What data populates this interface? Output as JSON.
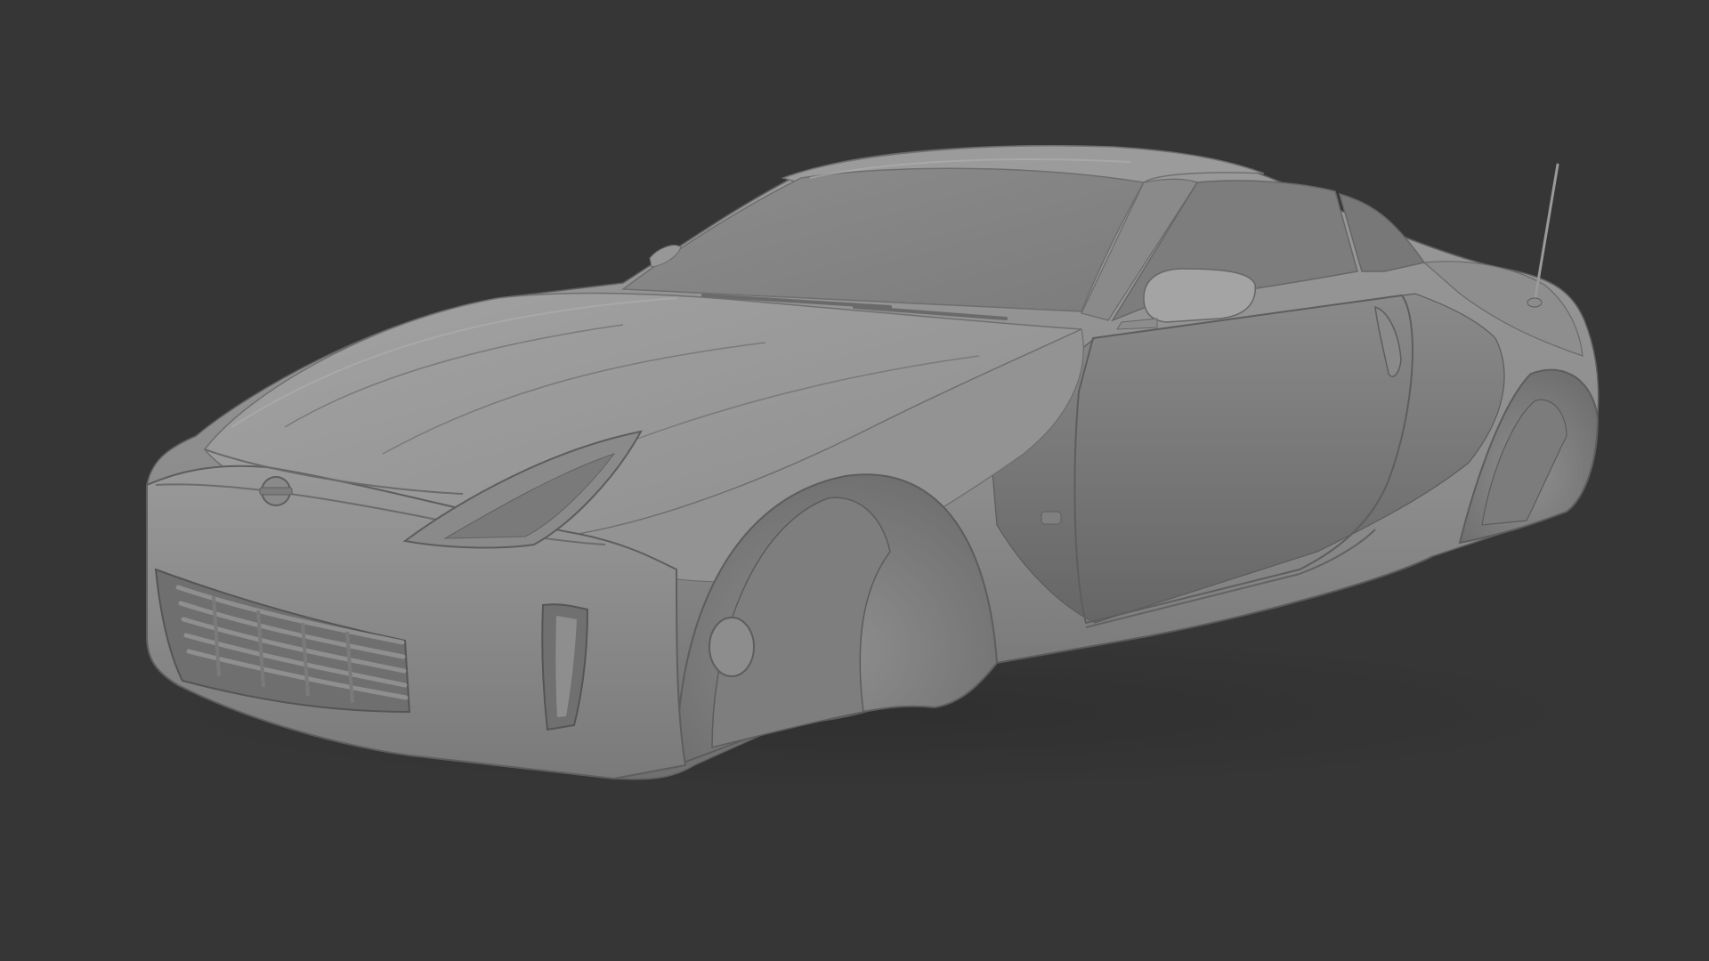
{
  "viewport": {
    "background_color": "#363636",
    "render_style": "clay-grey",
    "subject": "car-body-3d-model"
  },
  "model": {
    "base_color": "#8f8f8f",
    "highlight_color": "#a6a6a6",
    "shadow_color": "#5e5e5e",
    "edge_line_color": "#6a6a6a",
    "parts": [
      "body",
      "hood",
      "windshield",
      "roof",
      "side-window",
      "rear-window",
      "side-mirror",
      "door",
      "door-handle",
      "front-wheel-arch",
      "rear-wheel-arch",
      "front-bumper",
      "grille",
      "headlight",
      "fog-light-slot",
      "emblem",
      "antenna",
      "side-marker"
    ]
  }
}
